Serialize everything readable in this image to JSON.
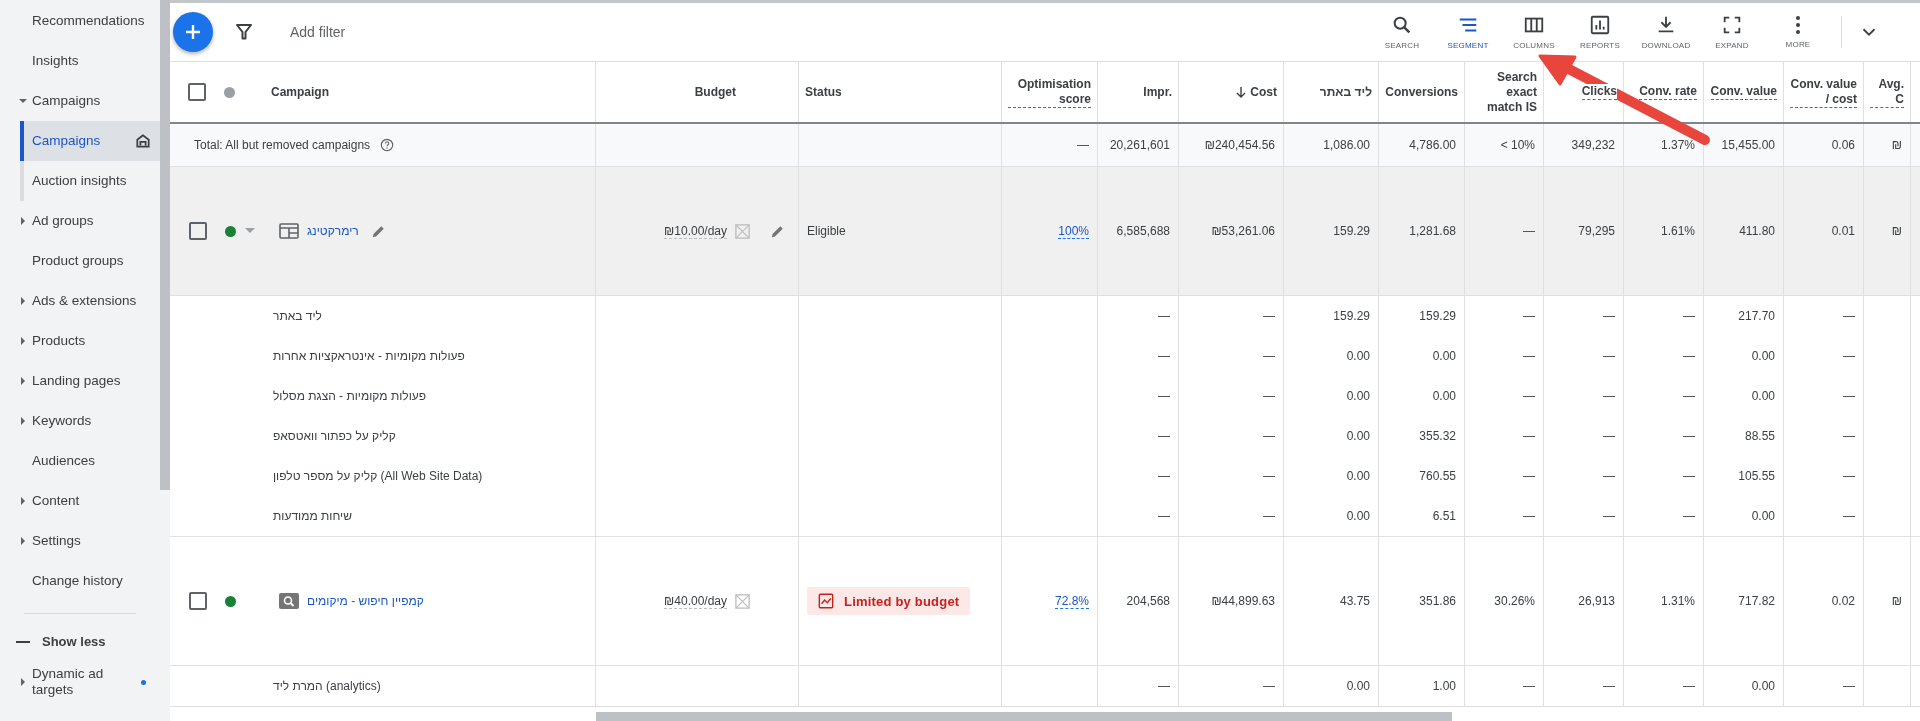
{
  "sidebar": {
    "items": [
      {
        "kind": "link",
        "label": "Recommendations",
        "selected": false
      },
      {
        "kind": "link",
        "label": "Insights",
        "selected": false
      },
      {
        "kind": "group",
        "label": "Campaigns",
        "expanded": true,
        "selected": false,
        "children": [
          {
            "label": "Campaigns",
            "selected": true,
            "home": true
          },
          {
            "label": "Auction insights",
            "selected": false,
            "home": false
          }
        ]
      },
      {
        "kind": "group",
        "label": "Ad groups",
        "expanded": false,
        "selected": false
      },
      {
        "kind": "link",
        "label": "Product groups",
        "selected": false
      },
      {
        "kind": "group",
        "label": "Ads & extensions",
        "expanded": false,
        "selected": false
      },
      {
        "kind": "group",
        "label": "Products",
        "expanded": false,
        "selected": false
      },
      {
        "kind": "group",
        "label": "Landing pages",
        "expanded": false,
        "selected": false
      },
      {
        "kind": "group",
        "label": "Keywords",
        "expanded": false,
        "selected": false
      },
      {
        "kind": "link",
        "label": "Audiences",
        "selected": false
      },
      {
        "kind": "group",
        "label": "Content",
        "expanded": false,
        "selected": false
      },
      {
        "kind": "group",
        "label": "Settings",
        "expanded": false,
        "selected": false
      },
      {
        "kind": "link",
        "label": "Change history",
        "selected": false
      }
    ],
    "show_less": "Show less",
    "more_items": [
      {
        "kind": "group",
        "label": "Dynamic ad targets",
        "expanded": false,
        "selected": false,
        "new_dot": true
      }
    ]
  },
  "toolbar": {
    "filter_placeholder": "Add filter",
    "tools": [
      {
        "kind": "search",
        "label": "SEARCH",
        "selected": false
      },
      {
        "kind": "segment",
        "label": "SEGMENT",
        "selected": true
      },
      {
        "kind": "columns",
        "label": "COLUMNS",
        "selected": false
      },
      {
        "kind": "reports",
        "label": "REPORTS",
        "selected": false
      },
      {
        "kind": "download",
        "label": "DOWNLOAD",
        "selected": false
      },
      {
        "kind": "expand",
        "label": "EXPAND",
        "selected": false
      },
      {
        "kind": "more",
        "label": "MORE",
        "selected": false
      }
    ]
  },
  "table": {
    "columns": [
      {
        "label": "Campaign",
        "dashed": false,
        "sorted": false
      },
      {
        "label": "Budget",
        "dashed": false,
        "sorted": false
      },
      {
        "label": "Status",
        "dashed": false,
        "sorted": false
      },
      {
        "label": "Optimisation score",
        "dashed": true,
        "sorted": false
      },
      {
        "label": "Impr.",
        "dashed": false,
        "sorted": false
      },
      {
        "label": "Cost",
        "dashed": false,
        "sorted": true
      },
      {
        "label": "ליד באתר",
        "dashed": false,
        "sorted": false
      },
      {
        "label": "Conversions",
        "dashed": false,
        "sorted": false
      },
      {
        "label": "Search exact match IS",
        "dashed": false,
        "sorted": false
      },
      {
        "label": "Clicks",
        "dashed": true,
        "sorted": false
      },
      {
        "label": "Conv. rate",
        "dashed": true,
        "sorted": false
      },
      {
        "label": "Conv. value",
        "dashed": true,
        "sorted": false
      },
      {
        "label": "Conv. value / cost",
        "dashed": true,
        "sorted": false
      },
      {
        "label": "Avg. C",
        "dashed": true,
        "sorted": false
      }
    ],
    "rows": [
      {
        "kind": "total",
        "cells": [
          "Total: All but removed campaigns",
          "",
          "",
          "—",
          "20,261,601",
          "₪240,454.56",
          "1,086.00",
          "4,786.00",
          "< 10%",
          "349,232",
          "1.37%",
          "15,455.00",
          "0.06",
          "₪"
        ]
      },
      {
        "kind": "campaign",
        "type_icon": {
          "kind": "display"
        },
        "color": "#188038",
        "hovered": true,
        "menu_caret": true,
        "name_editable": true,
        "budget_editable": true,
        "status_badge": {
          "kind": "eligible"
        },
        "cells": [
          "רימרקטינג",
          "₪10.00/day",
          "Eligible",
          "100%",
          "6,585,688",
          "₪53,261.06",
          "159.29",
          "1,281.68",
          "—",
          "79,295",
          "1.61%",
          "411.80",
          "0.01",
          "₪"
        ]
      },
      {
        "kind": "segment",
        "cells": [
          "ליד באתר",
          "",
          "",
          "",
          "—",
          "—",
          "159.29",
          "159.29",
          "—",
          "—",
          "—",
          "217.70",
          "—",
          ""
        ]
      },
      {
        "kind": "segment",
        "cells": [
          "פעולות מקומיות - אינטראקציות אחרות",
          "",
          "",
          "",
          "—",
          "—",
          "0.00",
          "0.00",
          "—",
          "—",
          "—",
          "0.00",
          "—",
          ""
        ]
      },
      {
        "kind": "segment",
        "cells": [
          "פעולות מקומיות - הצגת מסלול",
          "",
          "",
          "",
          "—",
          "—",
          "0.00",
          "0.00",
          "—",
          "—",
          "—",
          "0.00",
          "—",
          ""
        ]
      },
      {
        "kind": "segment",
        "cells": [
          "קליק על כפתור וואטסאפ",
          "",
          "",
          "",
          "—",
          "—",
          "0.00",
          "355.32",
          "—",
          "—",
          "—",
          "88.55",
          "—",
          ""
        ]
      },
      {
        "kind": "segment",
        "cells": [
          "קליק על מספר טלפון (All Web Site Data)",
          "",
          "",
          "",
          "—",
          "—",
          "0.00",
          "760.55",
          "—",
          "—",
          "—",
          "105.55",
          "—",
          ""
        ]
      },
      {
        "kind": "segment",
        "cells": [
          "שיחות ממודעות",
          "",
          "",
          "",
          "—",
          "—",
          "0.00",
          "6.51",
          "—",
          "—",
          "—",
          "0.00",
          "—",
          ""
        ]
      },
      {
        "kind": "campaign",
        "type_icon": {
          "kind": "search"
        },
        "color": "#188038",
        "hovered": false,
        "menu_caret": false,
        "name_editable": false,
        "budget_editable": false,
        "status_badge": {
          "kind": "limited"
        },
        "cells": [
          "קמפיין חיפוש - מיקומים",
          "₪40.00/day",
          "Limited by budget",
          "72.8%",
          "204,568",
          "₪44,899.63",
          "43.75",
          "351.86",
          "30.26%",
          "26,913",
          "1.31%",
          "717.82",
          "0.02",
          "₪"
        ]
      },
      {
        "kind": "segment",
        "cells": [
          "המרת ליד (analytics)",
          "",
          "",
          "",
          "—",
          "—",
          "0.00",
          "1.00",
          "—",
          "—",
          "—",
          "0.00",
          "—",
          ""
        ]
      }
    ]
  }
}
